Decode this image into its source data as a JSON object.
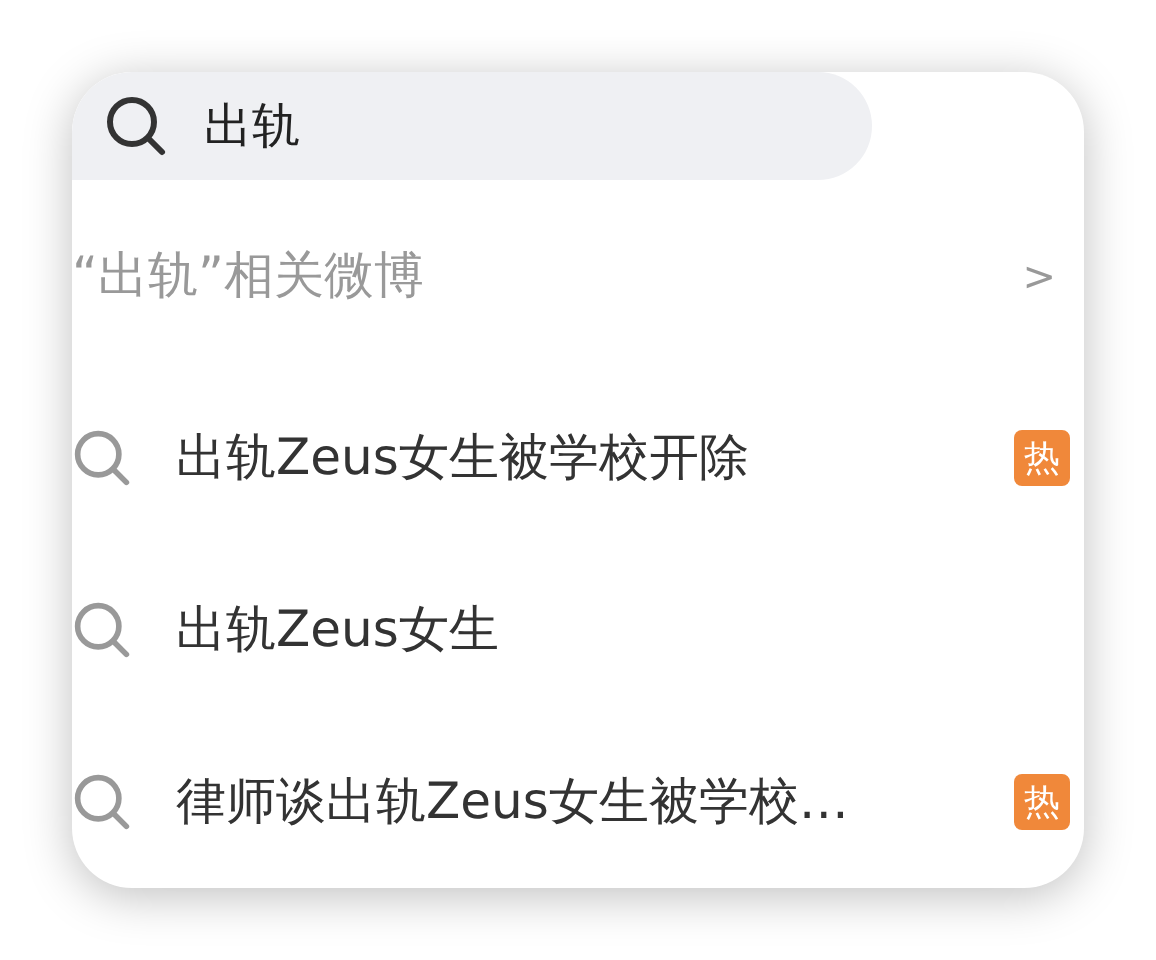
{
  "search": {
    "value": "出轨"
  },
  "related": {
    "label": "“出轨”相关微博",
    "arrow": ">"
  },
  "suggestions": [
    {
      "text": "出轨Zeus女生被学校开除",
      "badge": "热"
    },
    {
      "text": "出轨Zeus女生"
    },
    {
      "text": "律师谈出轨Zeus女生被学校…",
      "badge": "热"
    }
  ]
}
